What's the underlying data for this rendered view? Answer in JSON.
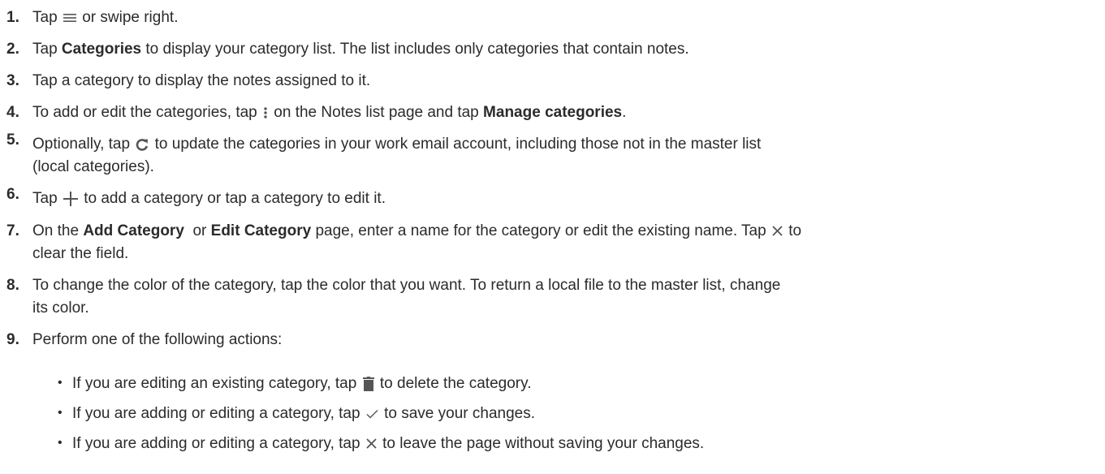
{
  "steps": [
    {
      "num": "1.",
      "parts": [
        "Tap",
        "or swipe right."
      ]
    },
    {
      "num": "2.",
      "parts": [
        "Tap",
        "Categories",
        "to display your category list. The list includes only categories that contain notes."
      ]
    },
    {
      "num": "3.",
      "parts": [
        "Tap a category to display the notes assigned to it."
      ]
    },
    {
      "num": "4.",
      "parts": [
        "To add or edit the categories, tap",
        "on the Notes list page and tap",
        "Manage categories",
        "."
      ]
    },
    {
      "num": "5.",
      "parts": [
        "Optionally, tap",
        "to update the categories in your work email account, including those not in the master list",
        "(local categories)."
      ]
    },
    {
      "num": "6.",
      "parts": [
        "Tap",
        "to add a category or tap a category to edit it."
      ]
    },
    {
      "num": "7.",
      "parts": [
        "On the",
        "Add Category",
        "or",
        "Edit Category",
        "page, enter a name for the category or edit the existing name. Tap",
        "to",
        "clear the field."
      ]
    },
    {
      "num": "8.",
      "parts": [
        "To change the color of the category, tap the color that you want. To return a local file to the master list, change",
        "its color."
      ]
    },
    {
      "num": "9.",
      "parts": [
        "Perform one of the following actions:"
      ]
    }
  ],
  "substeps": [
    {
      "bullet": "•",
      "parts": [
        "If you are editing an existing category, tap",
        "to delete the category."
      ]
    },
    {
      "bullet": "•",
      "parts": [
        "If you are adding or editing a category, tap",
        "to save your changes."
      ]
    },
    {
      "bullet": "•",
      "parts": [
        "If you are adding or editing a category, tap",
        "to leave the page without saving your changes."
      ]
    }
  ],
  "icons": {
    "menu": "menu-icon",
    "more": "more-vertical-icon",
    "refresh": "refresh-icon",
    "add": "plus-icon",
    "clear": "close-icon",
    "delete": "trash-icon",
    "save": "checkmark-icon"
  },
  "colors": {
    "text": "#2b2b2b",
    "icon": "#555555"
  }
}
